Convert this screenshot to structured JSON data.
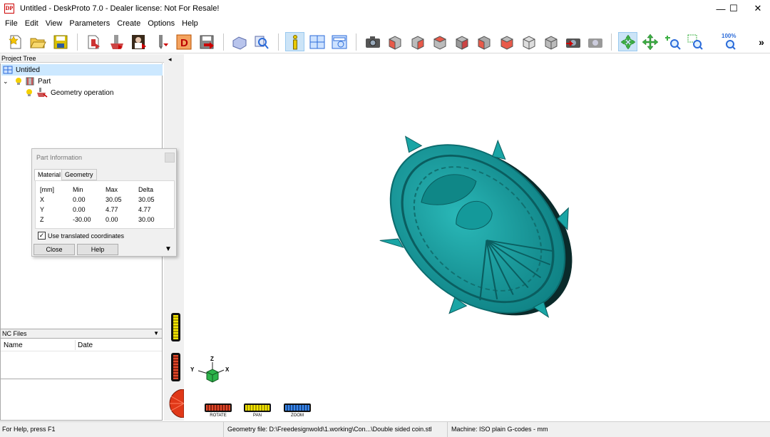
{
  "window": {
    "title": "Untitled - DeskProto 7.0 - Dealer license: Not For Resale!",
    "app_icon_text": "DP",
    "minimize": "—",
    "maximize": "☐",
    "close": "✕"
  },
  "menu": [
    "File",
    "Edit",
    "View",
    "Parameters",
    "Create",
    "Options",
    "Help"
  ],
  "toolbar": {
    "zoom_100_label": "100%",
    "overflow": "»",
    "buttons": [
      "new-project-icon",
      "open-project-icon",
      "save-project-icon",
      "import-geometry-icon",
      "geometry-operation-wizard-icon",
      "machine-wizard-icon",
      "tool-icon",
      "design-icon",
      "save-nc-icon",
      "calculate-icon",
      "preview-icon",
      "info-icon",
      "split-view-icon",
      "viewport-icon",
      "snapshot-icon",
      "view-front-icon",
      "view-back-icon",
      "view-left-icon",
      "view-right-icon",
      "view-top-icon",
      "view-bottom-icon",
      "view-iso-icon",
      "view-iso2-icon",
      "undo-view-icon",
      "redo-view-icon",
      "rotate-icon",
      "pan-icon",
      "zoom-icon",
      "zoom-window-icon",
      "zoom-all-icon"
    ]
  },
  "project_tree": {
    "header": "Project Tree",
    "root": "Untitled",
    "part": "Part",
    "operation": "Geometry operation"
  },
  "nc_files": {
    "header": "NC Files",
    "columns": [
      "Name",
      "Date"
    ]
  },
  "part_info": {
    "title": "Part Information",
    "tabs": [
      "Material",
      "Geometry"
    ],
    "headers": [
      "[mm]",
      "Min",
      "Max",
      "Delta"
    ],
    "rows": [
      {
        "axis": "X",
        "min": "0.00",
        "max": "30.05",
        "delta": "30.05"
      },
      {
        "axis": "Y",
        "min": "0.00",
        "max": "4.77",
        "delta": "4.77"
      },
      {
        "axis": "Z",
        "min": "-30.00",
        "max": "0.00",
        "delta": "30.00"
      }
    ],
    "checkbox_label": "Use translated coordinates",
    "checkbox_checked": true,
    "close_button": "Close",
    "help_button": "Help"
  },
  "viewport": {
    "model_color": "#1ea8a8",
    "axis_labels": {
      "x": "X",
      "y": "Y",
      "z": "Z"
    },
    "controls": {
      "rotate": "ROTATE",
      "pan": "PAN",
      "zoom": "ZOOM"
    },
    "collapse_arrow": "◂"
  },
  "status": {
    "help": "For Help, press F1",
    "geometry_file": "Geometry file: D:\\Freedesignwold\\1.working\\Con...\\Double sided coin.stl",
    "machine": "Machine: ISO plain G-codes - mm"
  }
}
